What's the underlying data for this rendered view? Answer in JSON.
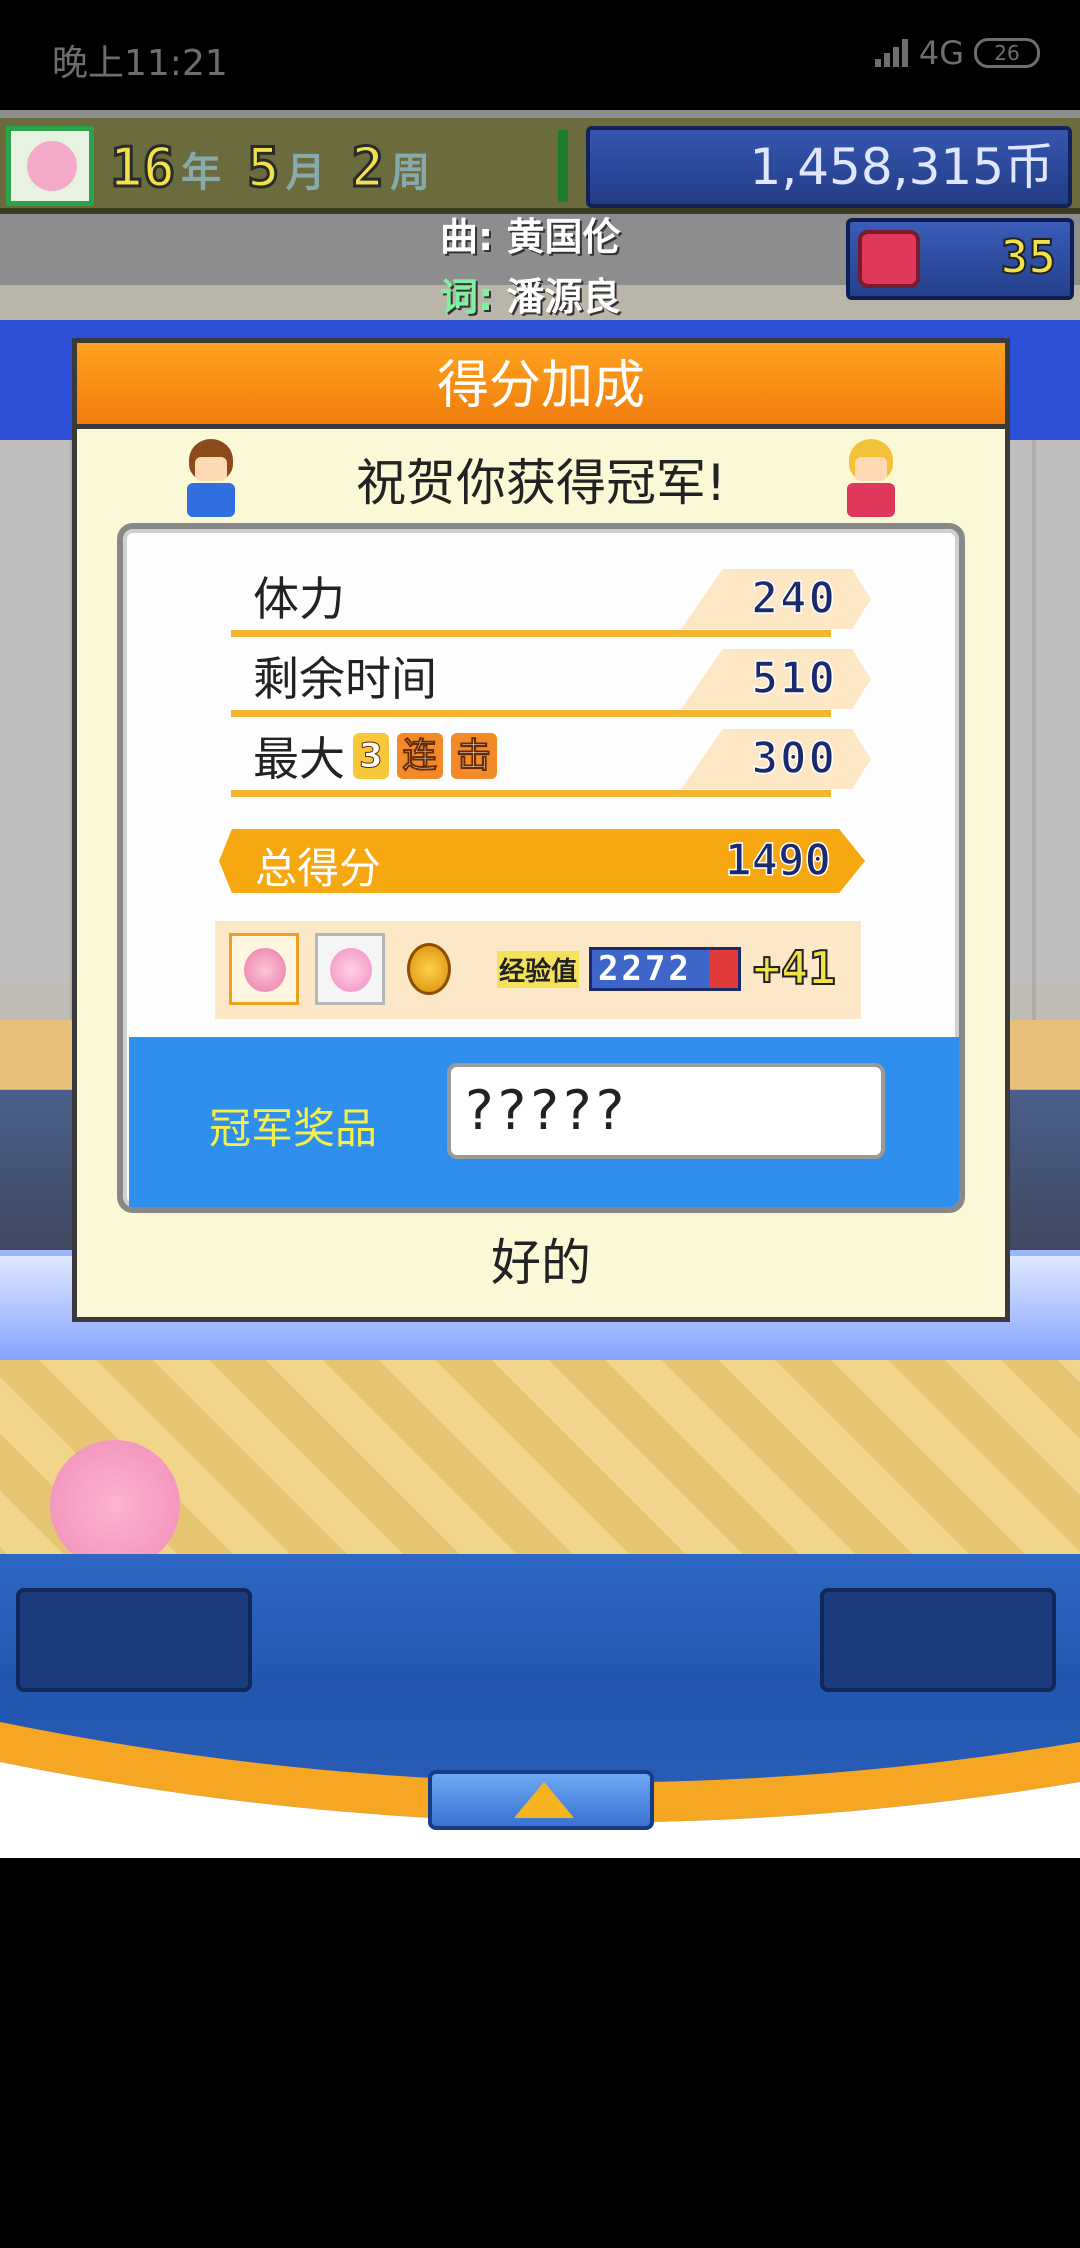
{
  "status_bar": {
    "time": "晚上11:21",
    "network": "4G",
    "battery": "26"
  },
  "hud": {
    "year": "16",
    "year_unit": "年",
    "month": "5",
    "month_unit": "月",
    "week": "2",
    "week_unit": "周",
    "money": "1,458,315币",
    "hearts": "35"
  },
  "lyrics": {
    "composer_label": "曲:",
    "composer": "黄国伦",
    "lyricist_label": "词:",
    "lyricist": "潘源良"
  },
  "dialog": {
    "title": "得分加成",
    "congrats": "祝贺你获得冠军!",
    "rows": [
      {
        "label": "体力",
        "value": "240"
      },
      {
        "label": "剩余时间",
        "value": "510"
      },
      {
        "label": "最大",
        "combo_count": "3",
        "combo_1": "连",
        "combo_2": "击",
        "value": "300"
      }
    ],
    "total_label": "总得分",
    "total_value": "1490",
    "exp_label": "经验值",
    "exp_value": "2272",
    "exp_gain": "+41",
    "prize_label": "冠军奖品",
    "prize_value": "?????",
    "ok_label": "好的"
  },
  "colors": {
    "title_orange": "#f7a70f",
    "prize_blue": "#2f8fec",
    "hud_money_blue": "#3556b0"
  }
}
